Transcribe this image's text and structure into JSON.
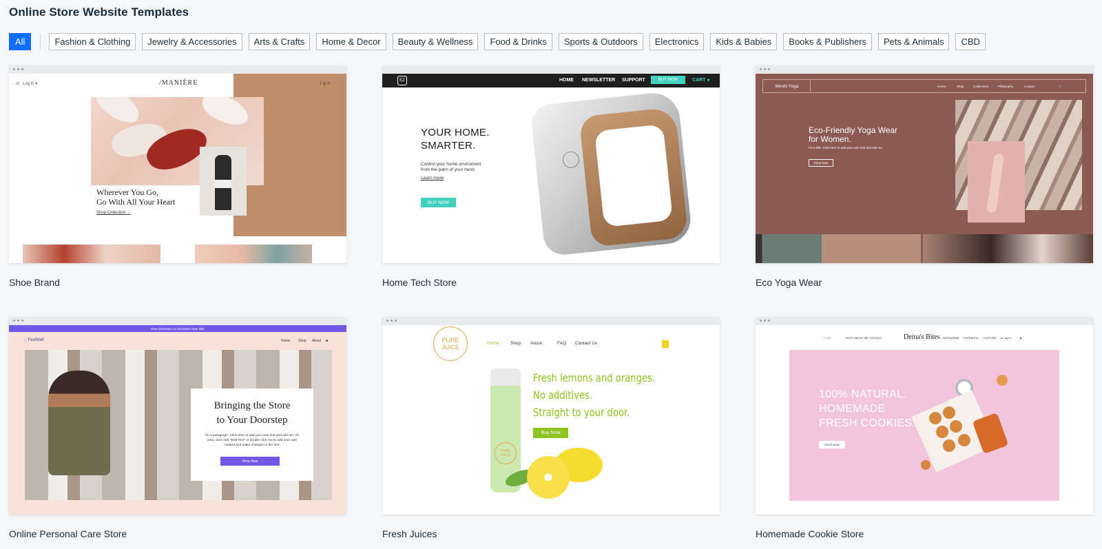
{
  "page": {
    "title": "Online Store Website Templates"
  },
  "filters": [
    "All",
    "Fashion & Clothing",
    "Jewelry & Accessories",
    "Arts & Crafts",
    "Home & Decor",
    "Beauty & Wellness",
    "Food & Drinks",
    "Sports & Outdoors",
    "Electronics",
    "Kids & Babies",
    "Books & Publishers",
    "Pets & Animals",
    "CBD"
  ],
  "colors": {
    "accent": "#116dff"
  },
  "templates": [
    {
      "name": "Shoe Brand",
      "preview": {
        "logo": "/MANIÈRE",
        "nav_left": "Log In",
        "headline_1": "Wherever You Go,",
        "headline_2": "Go With All Your Heart",
        "cta": "Shop Collection →"
      }
    },
    {
      "name": "Home Tech Store",
      "preview": {
        "logo": "EZ",
        "nav": [
          "HOME",
          "NEWSLETTER",
          "SUPPORT"
        ],
        "nav_button": "BUY NOW",
        "cart": "CART",
        "headline_1": "YOUR HOME.",
        "headline_2": "SMARTER.",
        "text_1": "Control your home enviroment",
        "text_2": "from the palm of your hand",
        "link": "Learn more",
        "button": "BUY NOW"
      }
    },
    {
      "name": "Eco Yoga Wear",
      "preview": {
        "brand": "Meshi Yoga",
        "nav": [
          "Home",
          "Shop",
          "Collections",
          "Philosophy",
          "Contact"
        ],
        "headline_1": "Eco-Friendly Yoga Wear",
        "headline_2": "for Women.",
        "text": "I'm a title. Click here to add your own text and edit me.",
        "button": "Shop Now"
      }
    },
    {
      "name": "Online Personal Care Store",
      "preview": {
        "promo": "Free Deliveries on all Orders Over $50",
        "logo": "FeelWell",
        "nav": [
          "Home",
          "Shop",
          "About"
        ],
        "headline_1": "Bringing the Store",
        "headline_2": "to Your Doorstep",
        "text": "I'm a paragraph. Click here to add your own text and edit me. It's easy. Just click \"Edit Text\" or double click me to add your own content and make changes to the font.",
        "button": "Shop Now"
      }
    },
    {
      "name": "Fresh Juices",
      "preview": {
        "logo_1": "PURE",
        "logo_2": "JUICE",
        "nav": [
          "Home",
          "Shop",
          "About",
          "FAQ",
          "Contact Us"
        ],
        "headline_1": "Fresh lemons and oranges.",
        "headline_2": "No additives.",
        "headline_3": "Straight to your door.",
        "button": "Buy Now"
      }
    },
    {
      "name": "Homemade Cookie Store",
      "preview": {
        "nav_left": [
          "HOME",
          "SHOP",
          "ABOUT ME",
          "CONTACT"
        ],
        "brand": "Deina's Bites",
        "nav_right": [
          "INSTAGRAM",
          "FACEBOOK",
          "YOUTUBE"
        ],
        "login": "Log In",
        "headline_1": "100% NATURAL.",
        "headline_2": "HOMEMADE",
        "headline_3": "FRESH COOKIES.",
        "button": "SHOP NOW"
      }
    }
  ]
}
